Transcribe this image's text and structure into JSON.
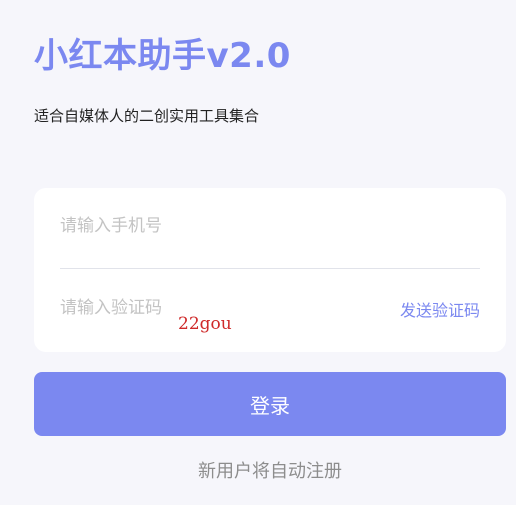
{
  "header": {
    "title": "小红本助手v2.0",
    "subtitle": "适合自媒体人的二创实用工具集合"
  },
  "form": {
    "phone_placeholder": "请输入手机号",
    "code_placeholder": "请输入验证码",
    "send_code_label": "发送验证码"
  },
  "watermark": "22gou",
  "actions": {
    "login_label": "登录"
  },
  "footer": {
    "note": "新用户将自动注册"
  },
  "colors": {
    "accent": "#7b88f0",
    "background": "#f6f6fb",
    "watermark": "#cf2a2a"
  }
}
